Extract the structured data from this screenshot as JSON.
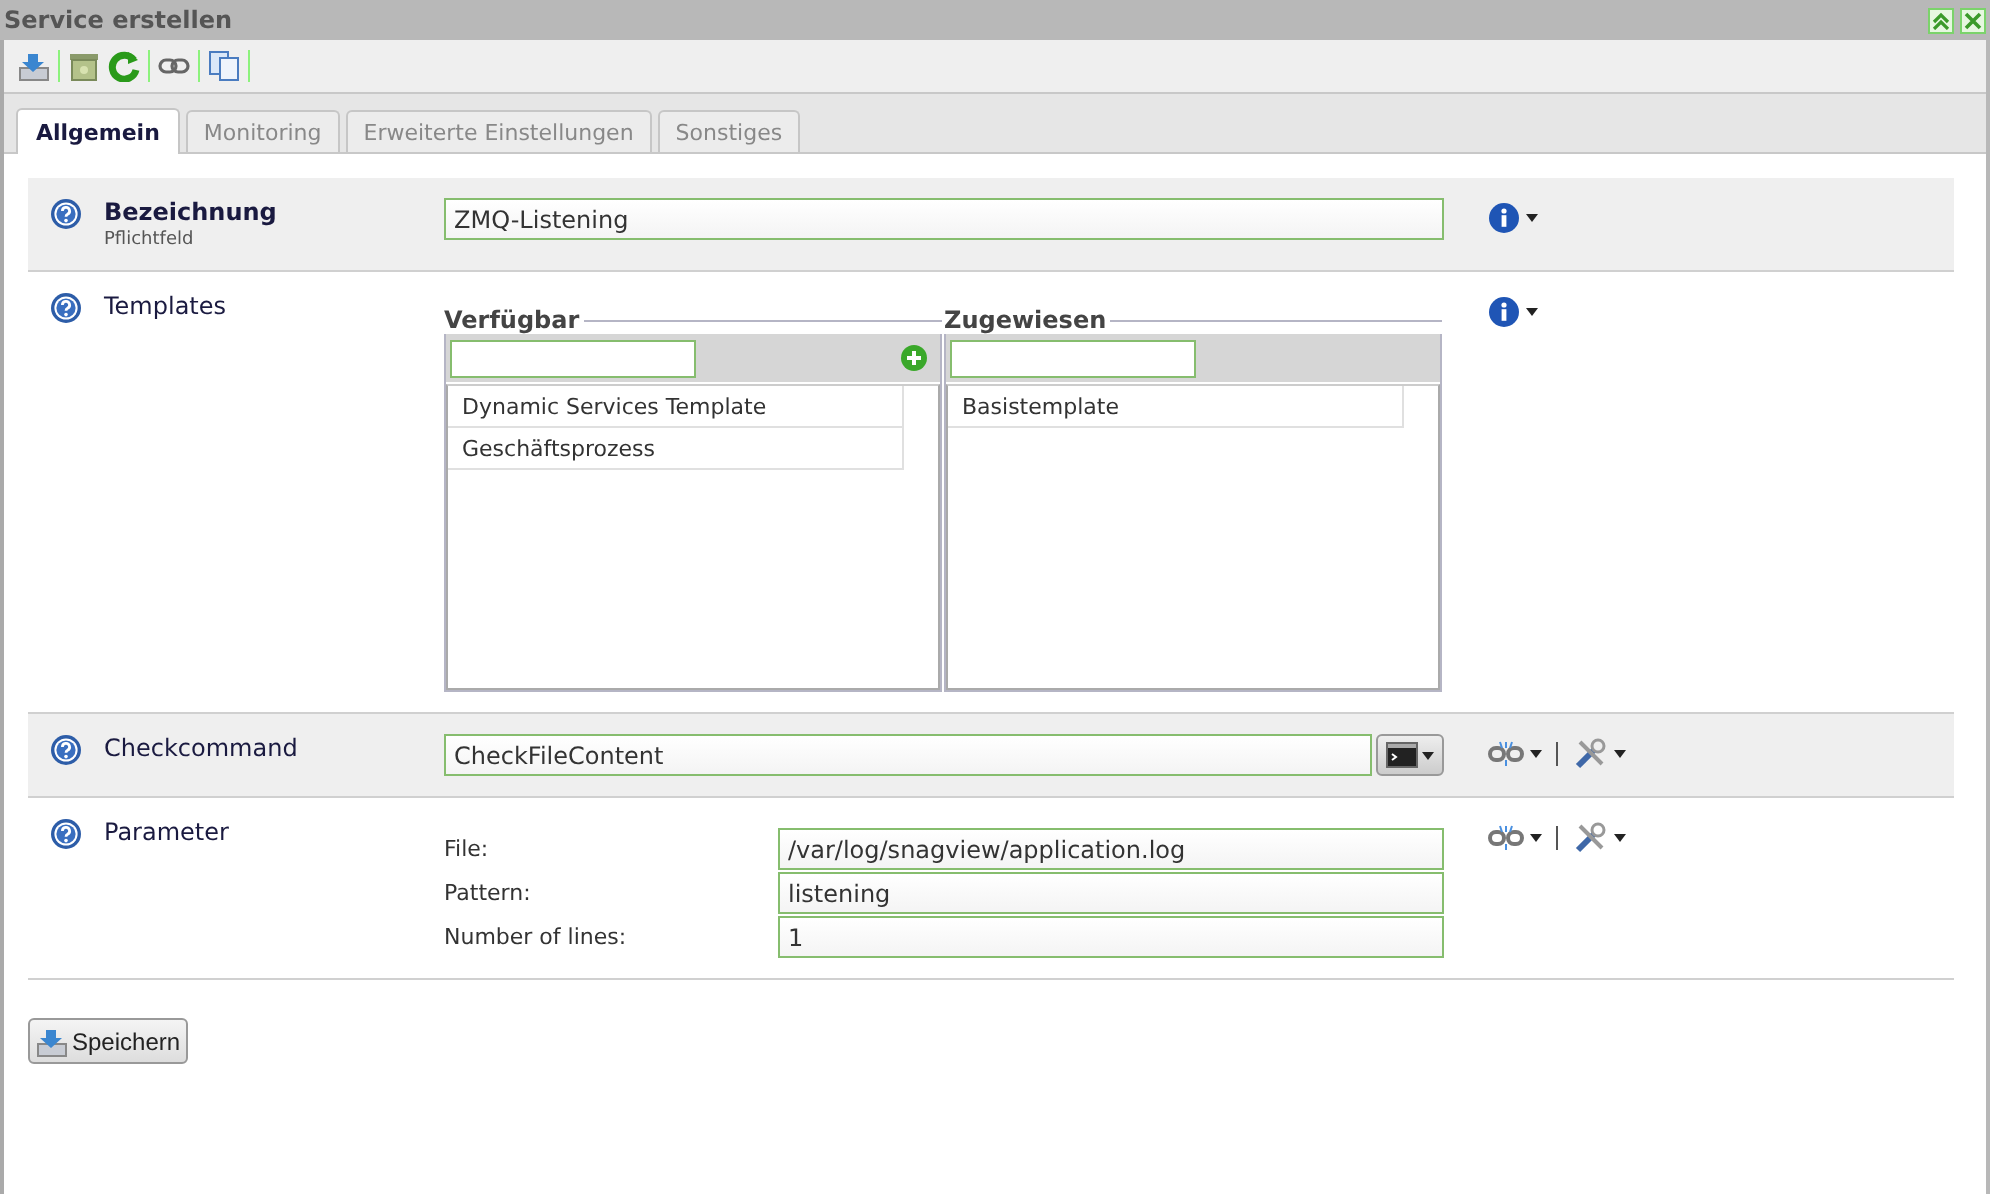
{
  "window": {
    "title": "Service erstellen"
  },
  "tabs": [
    {
      "label": "Allgemein",
      "selected": true
    },
    {
      "label": "Monitoring",
      "selected": false
    },
    {
      "label": "Erweiterte Einstellungen",
      "selected": false
    },
    {
      "label": "Sonstiges",
      "selected": false
    }
  ],
  "rows": [
    {
      "kind": "text",
      "label": "Bezeichnung",
      "required": true,
      "hint": "Pflichtfeld",
      "value": "ZMQ-Listening"
    },
    {
      "kind": "templates",
      "label": "Templates",
      "required": false,
      "available": {
        "legend": "Verfügbar",
        "items": [
          "Dynamic Services Template",
          "Geschäftsprozess"
        ]
      },
      "assigned": {
        "legend": "Zugewiesen",
        "items": [
          "Basistemplate"
        ]
      }
    },
    {
      "kind": "command",
      "label": "Checkcommand",
      "required": false,
      "value": "CheckFileContent"
    },
    {
      "kind": "parameters",
      "label": "Parameter",
      "required": false,
      "params": [
        {
          "name": "File:",
          "value": "/var/log/snagview/application.log"
        },
        {
          "name": "Pattern:",
          "value": "listening"
        },
        {
          "name": "Number of lines:",
          "value": "1"
        }
      ]
    }
  ],
  "save_button": {
    "label": "Speichern"
  }
}
